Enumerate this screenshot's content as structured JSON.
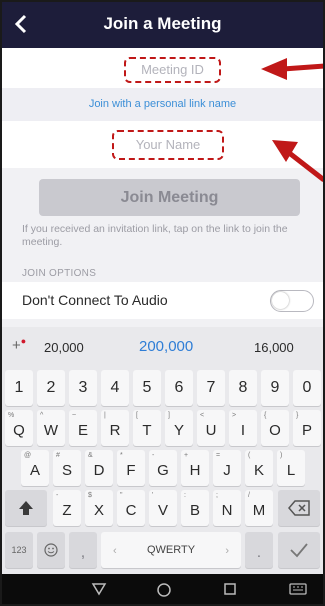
{
  "header": {
    "title": "Join a Meeting",
    "back_icon": "chevron-left-icon"
  },
  "meeting_id": {
    "placeholder": "Meeting ID"
  },
  "personal_link": {
    "label": "Join with a personal link name"
  },
  "your_name": {
    "placeholder": "Your Name"
  },
  "join_button": {
    "label": "Join Meeting"
  },
  "info_text": "If you received an invitation link, tap on the link to join the meeting.",
  "join_options": {
    "header": "JOIN OPTIONS",
    "dont_connect_audio": {
      "label": "Don't Connect To Audio",
      "enabled": false
    }
  },
  "keyboard": {
    "suggestions": [
      "20,000",
      "200,000",
      "16,000"
    ],
    "number_row": [
      "1",
      "2",
      "3",
      "4",
      "5",
      "6",
      "7",
      "8",
      "9",
      "0"
    ],
    "row1": [
      {
        "k": "Q",
        "s": "%"
      },
      {
        "k": "W",
        "s": "^"
      },
      {
        "k": "E",
        "s": "~"
      },
      {
        "k": "R",
        "s": "|"
      },
      {
        "k": "T",
        "s": "["
      },
      {
        "k": "Y",
        "s": "]"
      },
      {
        "k": "U",
        "s": "<"
      },
      {
        "k": "I",
        "s": ">"
      },
      {
        "k": "O",
        "s": "{"
      },
      {
        "k": "P",
        "s": "}"
      }
    ],
    "row2": [
      {
        "k": "A",
        "s": "@"
      },
      {
        "k": "S",
        "s": "#"
      },
      {
        "k": "D",
        "s": "&"
      },
      {
        "k": "F",
        "s": "*"
      },
      {
        "k": "G",
        "s": "-"
      },
      {
        "k": "H",
        "s": "+"
      },
      {
        "k": "J",
        "s": "="
      },
      {
        "k": "K",
        "s": "("
      },
      {
        "k": "L",
        "s": ")"
      }
    ],
    "row3": [
      {
        "k": "Z",
        "s": "-"
      },
      {
        "k": "X",
        "s": "$"
      },
      {
        "k": "C",
        "s": "\""
      },
      {
        "k": "V",
        "s": "'"
      },
      {
        "k": "B",
        "s": ":"
      },
      {
        "k": "N",
        "s": ";"
      },
      {
        "k": "M",
        "s": "/"
      }
    ],
    "sym_key": "123",
    "space_label": "QWERTY",
    "comma": ",",
    "period": "."
  },
  "colors": {
    "header_bg": "#1d1d3a",
    "link": "#3c8fd7",
    "annotation": "#c01818"
  }
}
